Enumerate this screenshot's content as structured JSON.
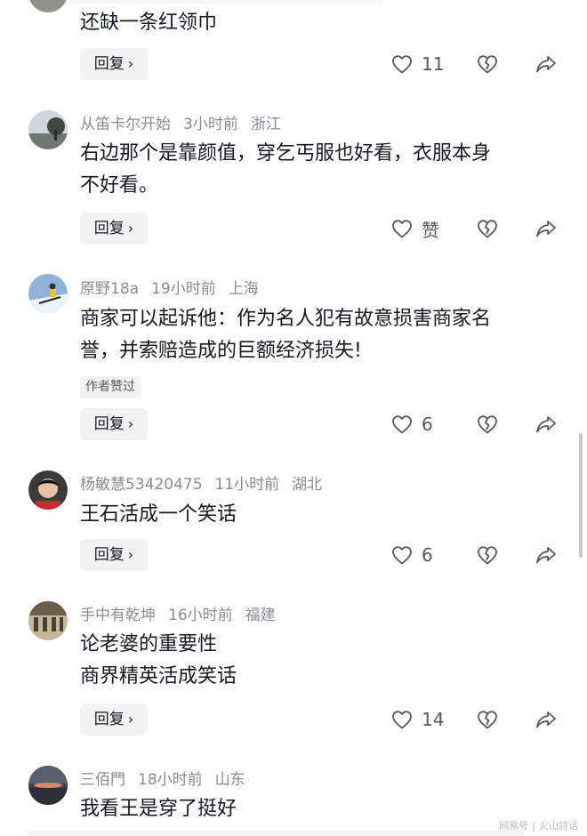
{
  "comments": [
    {
      "text_lines": [
        "还缺一条红领巾"
      ],
      "reply_label": "回复",
      "like_count": "11"
    },
    {
      "username": "从笛卡尔开始",
      "time": "3小时前",
      "location": "浙江",
      "text_lines": [
        "右边那个是靠颜值，穿乞丐服也好看，衣服本身",
        "不好看。"
      ],
      "reply_label": "回复",
      "like_count": "赞"
    },
    {
      "username": "原野18a",
      "time": "19小时前",
      "location": "上海",
      "text_lines": [
        "商家可以起诉他：作为名人犯有故意损害商家名",
        "誉，并索赔造成的巨额经济损失!"
      ],
      "author_liked": "作者赞过",
      "reply_label": "回复",
      "like_count": "6"
    },
    {
      "username": "杨敏慧53420475",
      "time": "11小时前",
      "location": "湖北",
      "text_lines": [
        "王石活成一个笑话"
      ],
      "reply_label": "回复",
      "like_count": "6"
    },
    {
      "username": "手中有乾坤",
      "time": "16小时前",
      "location": "福建",
      "text_lines": [
        "论老婆的重要性",
        "商界精英活成笑话"
      ],
      "reply_label": "回复",
      "like_count": "14"
    },
    {
      "username": "三佰門",
      "time": "18小时前",
      "location": "山东",
      "text_lines": [
        "我看王是穿了挺好"
      ]
    }
  ],
  "watermark": {
    "left": "网易号",
    "right": "火山詩话"
  },
  "icons": {
    "like": "heart-icon",
    "dislike": "broken-heart-icon",
    "share": "share-arrow-icon",
    "reply_chevron": "chevron-right-icon"
  },
  "colors": {
    "text_primary": "#161823",
    "text_secondary": "#8a8b91",
    "button_bg": "#f2f2f3"
  }
}
